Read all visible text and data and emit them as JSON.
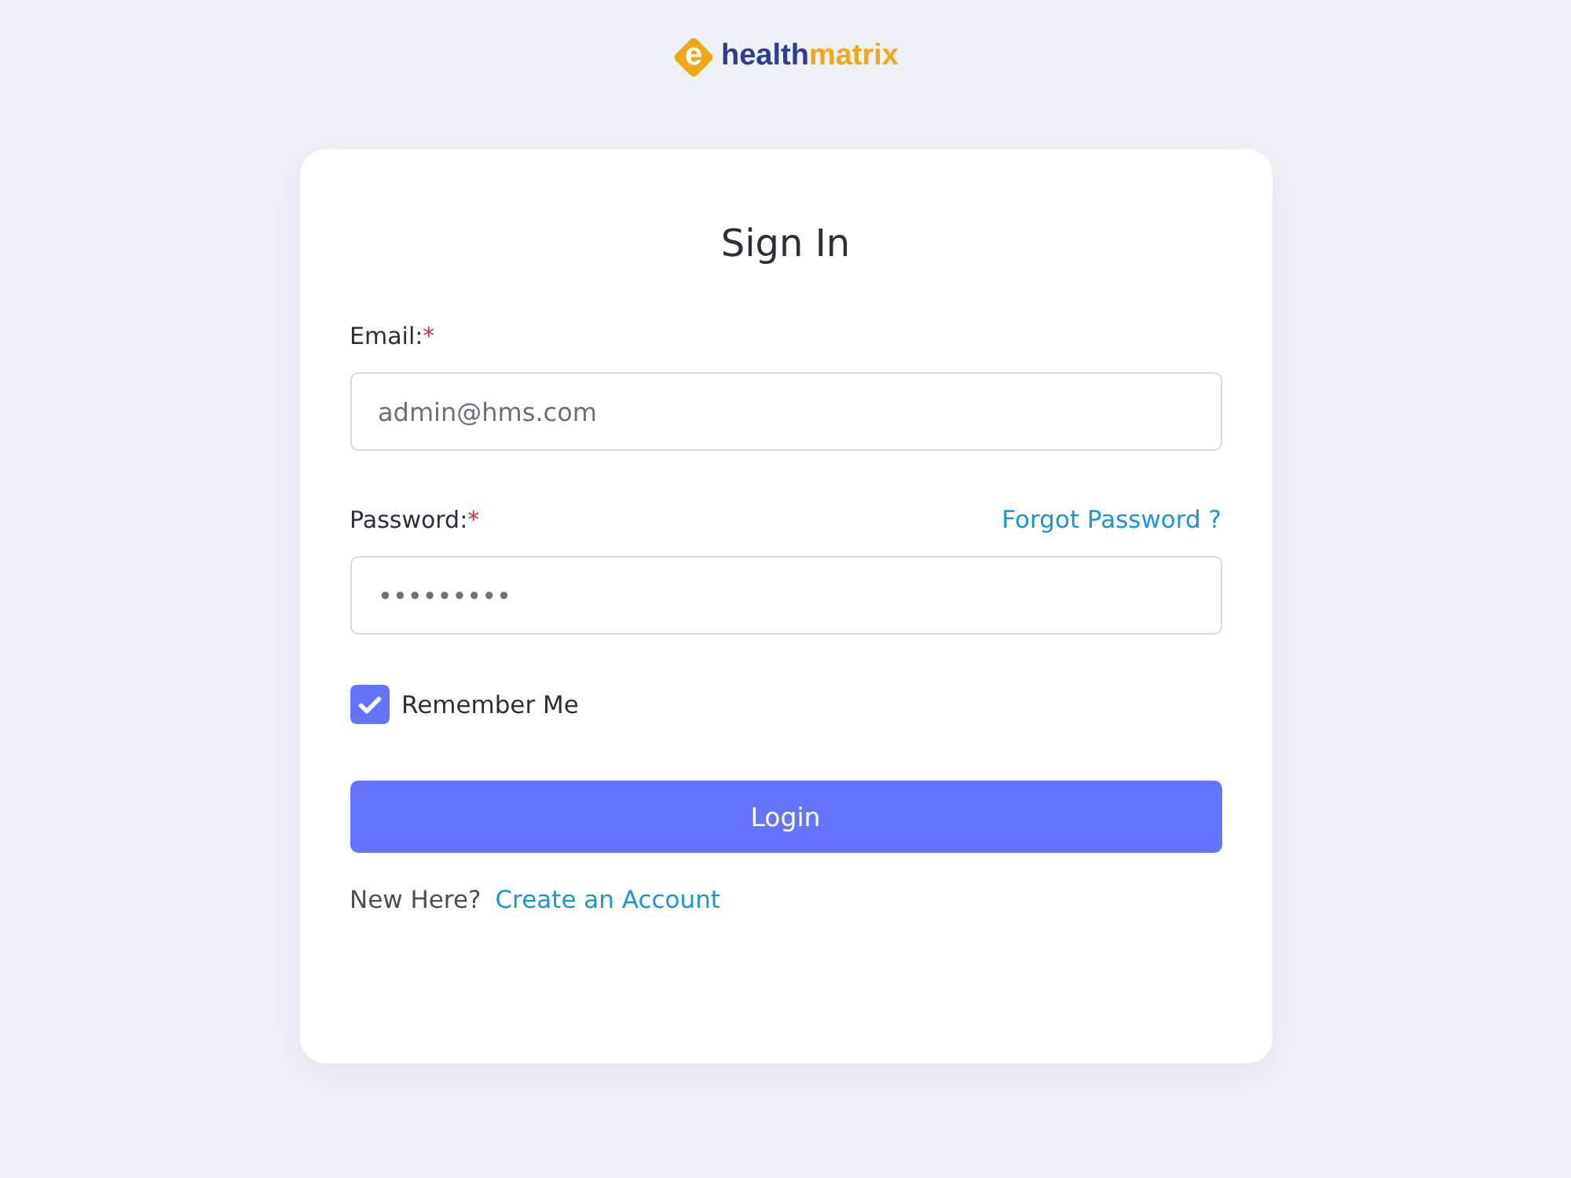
{
  "logo": {
    "mark": "e",
    "wordmark": [
      {
        "text": "health",
        "color": "#2e3b8f"
      },
      {
        "text": "matrix",
        "color": "#f2a71b"
      }
    ]
  },
  "title": "Sign In",
  "email": {
    "label": "Email:",
    "required_mark": "*",
    "placeholder": "admin@hms.com"
  },
  "password": {
    "label": "Password:",
    "required_mark": "*",
    "value": "•••••••••",
    "link": "Forgot Password ?"
  },
  "remember_me": {
    "label": "Remember Me",
    "checked": true
  },
  "login_button": "Login",
  "signup": {
    "prompt": "New Here?",
    "link": "Create an Account"
  }
}
